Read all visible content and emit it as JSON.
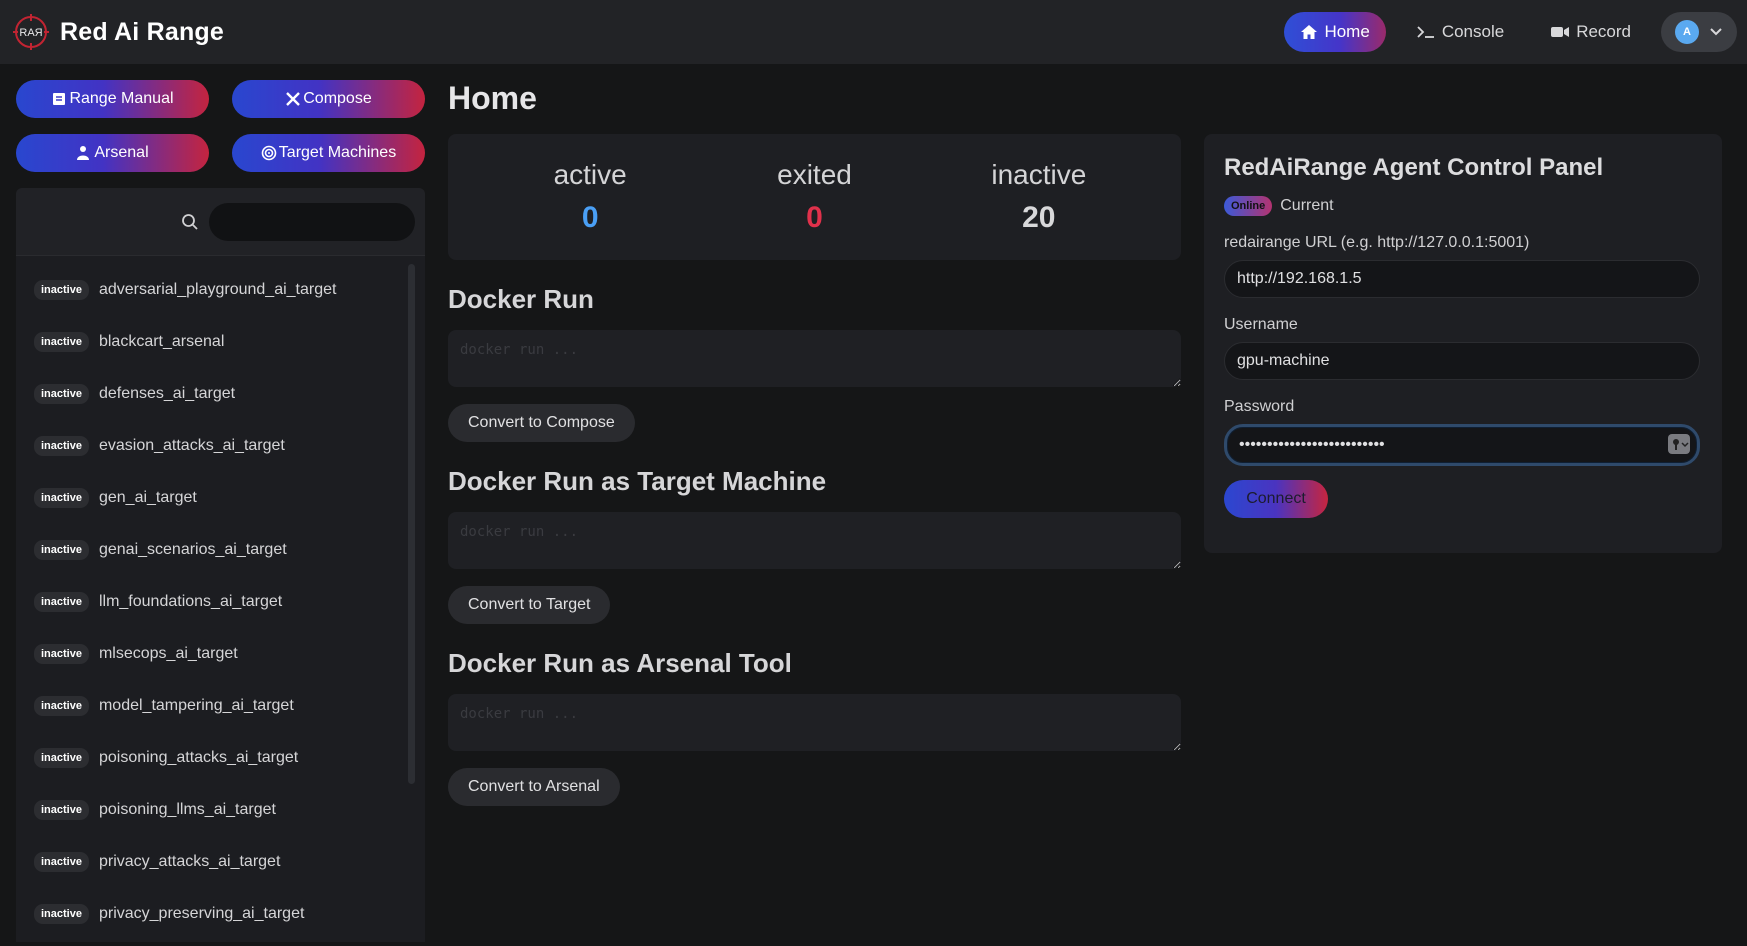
{
  "brand": {
    "title": "Red Ai Range",
    "logo_text": "RAЯ"
  },
  "nav": {
    "home": "Home",
    "console": "Console",
    "record": "Record",
    "avatar_initial": "A"
  },
  "sidebar": {
    "buttons": [
      "Range Manual",
      "Compose",
      "Arsenal",
      "Target Machines"
    ],
    "search_placeholder": "",
    "items": [
      {
        "status": "inactive",
        "name": "adversarial_playground_ai_target"
      },
      {
        "status": "inactive",
        "name": "blackcart_arsenal"
      },
      {
        "status": "inactive",
        "name": "defenses_ai_target"
      },
      {
        "status": "inactive",
        "name": "evasion_attacks_ai_target"
      },
      {
        "status": "inactive",
        "name": "gen_ai_target"
      },
      {
        "status": "inactive",
        "name": "genai_scenarios_ai_target"
      },
      {
        "status": "inactive",
        "name": "llm_foundations_ai_target"
      },
      {
        "status": "inactive",
        "name": "mlsecops_ai_target"
      },
      {
        "status": "inactive",
        "name": "model_tampering_ai_target"
      },
      {
        "status": "inactive",
        "name": "poisoning_attacks_ai_target"
      },
      {
        "status": "inactive",
        "name": "poisoning_llms_ai_target"
      },
      {
        "status": "inactive",
        "name": "privacy_attacks_ai_target"
      },
      {
        "status": "inactive",
        "name": "privacy_preserving_ai_target"
      }
    ]
  },
  "main": {
    "title": "Home",
    "stats": [
      {
        "label": "active",
        "value": "0",
        "color": "#4a9ff5"
      },
      {
        "label": "exited",
        "value": "0",
        "color": "#e0314b"
      },
      {
        "label": "inactive",
        "value": "20",
        "color": "#d8d8da"
      }
    ],
    "docker_run": {
      "title": "Docker Run",
      "placeholder": "docker run ...",
      "button": "Convert to Compose"
    },
    "docker_target": {
      "title": "Docker Run as Target Machine",
      "placeholder": "docker run ...",
      "button": "Convert to Target"
    },
    "docker_arsenal": {
      "title": "Docker Run as Arsenal Tool",
      "placeholder": "docker run ...",
      "button": "Convert to Arsenal"
    }
  },
  "agent": {
    "title": "RedAiRange Agent Control Panel",
    "status_badge": "Online",
    "status_text": "Current",
    "url_label": "redairange URL (e.g. http://127.0.0.1:5001)",
    "url_value": "http://192.168.1.5",
    "username_label": "Username",
    "username_value": "gpu-machine",
    "password_label": "Password",
    "password_value": "••••••••••••••••••••••••••",
    "connect": "Connect"
  },
  "colors": {
    "accent_blue": "#2f4fd6",
    "accent_red": "#c4243f",
    "background": "#151617"
  }
}
